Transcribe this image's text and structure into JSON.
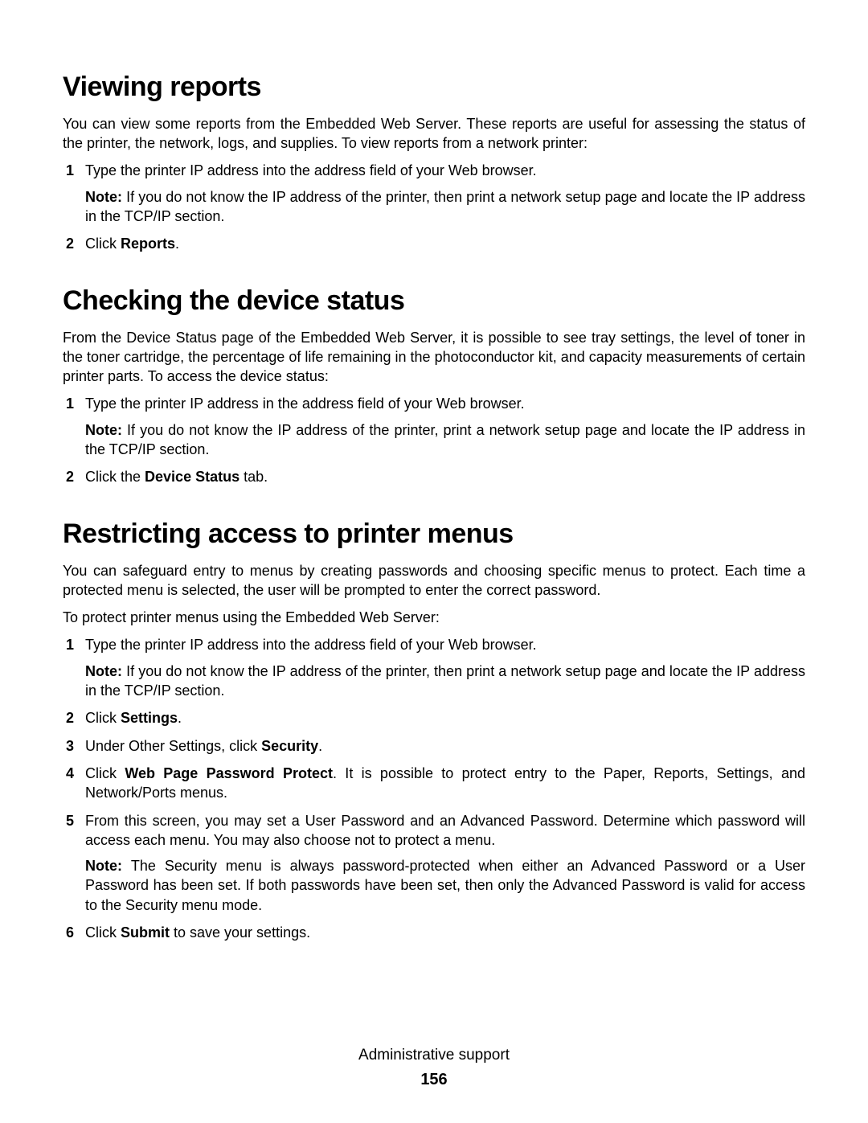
{
  "sections": [
    {
      "title": "Viewing reports",
      "intro": "You can view some reports from the Embedded Web Server. These reports are useful for assessing the status of the printer, the network, logs, and supplies. To view reports from a network printer:",
      "steps": [
        {
          "text_before": "Type the printer IP address into the address field of your Web browser.",
          "note": "If you do not know the IP address of the printer, then print a network setup page and locate the IP address in the TCP/IP section."
        },
        {
          "text_before": "Click ",
          "bold": "Reports",
          "text_after": "."
        }
      ]
    },
    {
      "title": "Checking the device status",
      "intro": "From the Device Status page of the Embedded Web Server, it is possible to see tray settings, the level of toner in the toner cartridge, the percentage of life remaining in the photoconductor kit, and capacity measurements of certain printer parts. To access the device status:",
      "steps": [
        {
          "text_before": "Type the printer IP address in the address field of your Web browser.",
          "note": "If you do not know the IP address of the printer, print a network setup page and locate the IP address in the TCP/IP section."
        },
        {
          "text_before": "Click the ",
          "bold": "Device Status",
          "text_after": " tab."
        }
      ]
    },
    {
      "title": "Restricting access to printer menus",
      "intro": "You can safeguard entry to menus by creating passwords and choosing specific menus to protect. Each time a protected menu is selected, the user will be prompted to enter the correct password.",
      "intro2": "To protect printer menus using the Embedded Web Server:",
      "steps": [
        {
          "text_before": "Type the printer IP address into the address field of your Web browser.",
          "note": "If you do not know the IP address of the printer, then print a network setup page and locate the IP address in the TCP/IP section."
        },
        {
          "text_before": "Click ",
          "bold": "Settings",
          "text_after": "."
        },
        {
          "text_before": "Under Other Settings, click ",
          "bold": "Security",
          "text_after": "."
        },
        {
          "text_before": "Click ",
          "bold": "Web Page Password Protect",
          "text_after": ". It is possible to protect entry to the Paper, Reports, Settings, and Network/Ports menus."
        },
        {
          "text_before": "From this screen, you may set a User Password and an Advanced Password. Determine which password will access each menu. You may also choose not to protect a menu.",
          "note": "The Security menu is always password-protected when either an Advanced Password or a User Password has been set. If both passwords have been set, then only the Advanced Password is valid for access to the Security menu mode."
        },
        {
          "text_before": "Click ",
          "bold": "Submit",
          "text_after": " to save your settings."
        }
      ]
    }
  ],
  "note_label": "Note: ",
  "footer": {
    "chapter": "Administrative support",
    "page_number": "156"
  }
}
